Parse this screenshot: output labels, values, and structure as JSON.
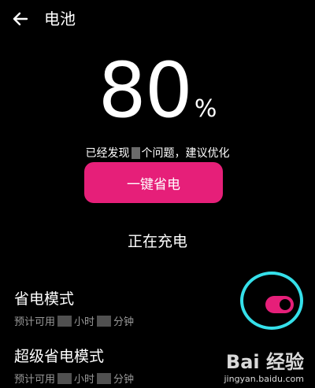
{
  "header": {
    "title": "电池"
  },
  "battery": {
    "percent": "80",
    "percent_sign": "%"
  },
  "issues": {
    "prefix": "已经发现",
    "suffix": "个问题，建议优化"
  },
  "optimize_button": {
    "label": "一键省电"
  },
  "charging_status": "正在充电",
  "power_saving": {
    "title": "省电模式",
    "sub_prefix": "预计可用",
    "hour_unit": "小时",
    "minute_unit": "分钟",
    "enabled": true
  },
  "super_power_saving": {
    "title": "超级省电模式",
    "sub_prefix": "预计可用",
    "hour_unit": "小时",
    "minute_unit": "分钟"
  },
  "colors": {
    "accent": "#e61f79",
    "highlight": "#35e0ea",
    "background": "#000000"
  },
  "watermark": {
    "logo": "Bai 经验",
    "url": "jingyan.baidu.com"
  }
}
